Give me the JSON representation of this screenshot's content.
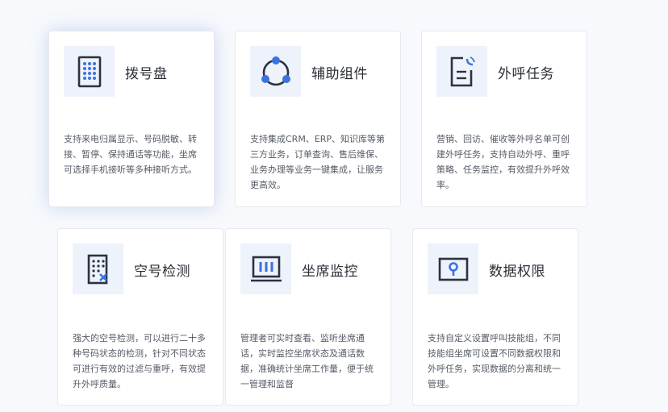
{
  "features": [
    {
      "title": "拨号盘",
      "desc": "支持来电归属显示、号码脱敏、转接、暂停、保持通话等功能，坐席可选择手机接听等多种接听方式。",
      "icon": "dialpad-icon"
    },
    {
      "title": "辅助组件",
      "desc": "支持集成CRM、ERP、知识库等第三方业务，订单查询、售后维保、业务办理等业务一键集成，让服务更高效。",
      "icon": "integration-icon"
    },
    {
      "title": "外呼任务",
      "desc": "营销、回访、催收等外呼名单可创建外呼任务，支持自动外呼、重呼策略、任务监控，有效提升外呼效率。",
      "icon": "outbound-task-icon"
    },
    {
      "title": "空号检测",
      "desc": "强大的空号检测，可以进行二十多种号码状态的检测，针对不同状态可进行有效的过滤与重呼，有效提升外呼质量。",
      "icon": "empty-number-icon"
    },
    {
      "title": "坐席监控",
      "desc": "管理者可实时查看、监听坐席通话，实时监控坐席状态及通话数据，准确统计坐席工作量，便于统一管理和监督",
      "icon": "agent-monitor-icon"
    },
    {
      "title": "数据权限",
      "desc": "支持自定义设置呼叫技能组，不同技能组坐席可设置不同数据权限和外呼任务，实现数据的分离和统一管理。",
      "icon": "data-permission-icon"
    }
  ],
  "colors": {
    "accent": "#3b73e0",
    "icon_dark": "#2b3240",
    "icon_bg": "#eef2fa"
  }
}
